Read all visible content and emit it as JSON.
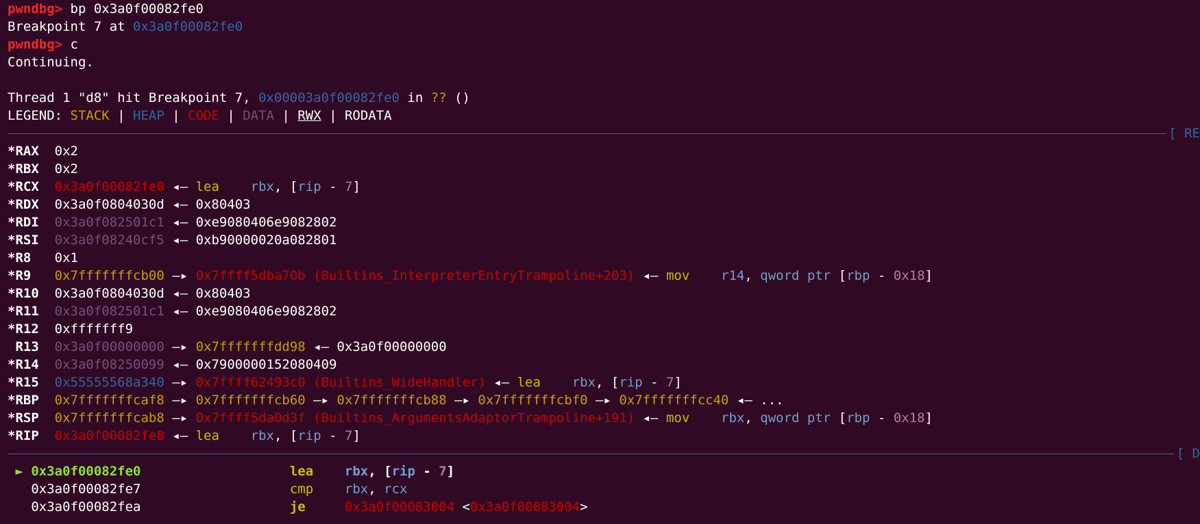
{
  "colors": {
    "background": "#300a24",
    "white": "#ffffff",
    "prompt_red": "#ef2929",
    "code_red": "#cc0000",
    "heap_blue": "#3465a4",
    "stack_yellow": "#c4a000",
    "data_purple": "#75507b",
    "reg_cyan": "#729fcf",
    "num_purple": "#ad7fa8",
    "mnem_yellow": "#c4c400",
    "green": "#8ae234",
    "sep_blue": "#3465a4"
  },
  "terminal": {
    "lines": [
      {
        "kind": "text",
        "segs": [
          {
            "t": "pwndbg> ",
            "c": "prompt_red",
            "b": true
          },
          {
            "t": "bp 0x3a0f00082fe0",
            "c": "white"
          }
        ]
      },
      {
        "kind": "text",
        "segs": [
          {
            "t": "Breakpoint 7 at ",
            "c": "white"
          },
          {
            "t": "0x3a0f00082fe0",
            "c": "heap_blue"
          }
        ]
      },
      {
        "kind": "text",
        "segs": [
          {
            "t": "pwndbg> ",
            "c": "prompt_red",
            "b": true
          },
          {
            "t": "c",
            "c": "white"
          }
        ]
      },
      {
        "kind": "text",
        "segs": [
          {
            "t": "Continuing.",
            "c": "white"
          }
        ]
      },
      {
        "kind": "text",
        "segs": []
      },
      {
        "kind": "text",
        "segs": [
          {
            "t": "Thread 1 \"d8\" hit Breakpoint 7, ",
            "c": "white"
          },
          {
            "t": "0x00003a0f00082fe0",
            "c": "heap_blue"
          },
          {
            "t": " in ",
            "c": "white"
          },
          {
            "t": "??",
            "c": "stack_yellow"
          },
          {
            "t": " ()",
            "c": "white"
          }
        ]
      },
      {
        "kind": "text",
        "segs": [
          {
            "t": "LEGEND: ",
            "c": "white"
          },
          {
            "t": "STACK",
            "c": "stack_yellow"
          },
          {
            "t": " | ",
            "c": "white"
          },
          {
            "t": "HEAP",
            "c": "heap_blue"
          },
          {
            "t": " | ",
            "c": "white"
          },
          {
            "t": "CODE",
            "c": "code_red"
          },
          {
            "t": " | ",
            "c": "white"
          },
          {
            "t": "DATA",
            "c": "data_purple"
          },
          {
            "t": " | ",
            "c": "white"
          },
          {
            "t": "RWX",
            "c": "white",
            "u": true
          },
          {
            "t": " | RODATA",
            "c": "white"
          }
        ]
      },
      {
        "kind": "sep",
        "label": "[ RE"
      },
      {
        "kind": "text",
        "segs": [
          {
            "t": "*RAX",
            "c": "white",
            "b": true
          },
          {
            "t": "  0x2",
            "c": "white"
          }
        ]
      },
      {
        "kind": "text",
        "segs": [
          {
            "t": "*RBX",
            "c": "white",
            "b": true
          },
          {
            "t": "  0x2",
            "c": "white"
          }
        ]
      },
      {
        "kind": "text",
        "segs": [
          {
            "t": "*RCX",
            "c": "white",
            "b": true
          },
          {
            "t": "  ",
            "c": "white"
          },
          {
            "t": "0x3a0f00082fe0",
            "c": "code_red"
          },
          {
            "t": " ◂— ",
            "c": "white"
          },
          {
            "t": "lea",
            "c": "mnem_yellow"
          },
          {
            "t": "    ",
            "c": "white"
          },
          {
            "t": "rbx",
            "c": "reg_cyan"
          },
          {
            "t": ", [",
            "c": "white"
          },
          {
            "t": "rip",
            "c": "reg_cyan"
          },
          {
            "t": " - ",
            "c": "white"
          },
          {
            "t": "7",
            "c": "num_purple"
          },
          {
            "t": "]",
            "c": "white"
          }
        ]
      },
      {
        "kind": "text",
        "segs": [
          {
            "t": "*RDX",
            "c": "white",
            "b": true
          },
          {
            "t": "  0x3a0f0804030d ◂— 0x80403",
            "c": "white"
          }
        ]
      },
      {
        "kind": "text",
        "segs": [
          {
            "t": "*RDI",
            "c": "white",
            "b": true
          },
          {
            "t": "  ",
            "c": "white"
          },
          {
            "t": "0x3a0f082501c1",
            "c": "data_purple"
          },
          {
            "t": " ◂— 0xe9080406e9082802",
            "c": "white"
          }
        ]
      },
      {
        "kind": "text",
        "segs": [
          {
            "t": "*RSI",
            "c": "white",
            "b": true
          },
          {
            "t": "  ",
            "c": "white"
          },
          {
            "t": "0x3a0f08240cf5",
            "c": "data_purple"
          },
          {
            "t": " ◂— 0xb90000020a082801",
            "c": "white"
          }
        ]
      },
      {
        "kind": "text",
        "segs": [
          {
            "t": "*R8",
            "c": "white",
            "b": true
          },
          {
            "t": "   0x1",
            "c": "white"
          }
        ]
      },
      {
        "kind": "text",
        "segs": [
          {
            "t": "*R9",
            "c": "white",
            "b": true
          },
          {
            "t": "   ",
            "c": "white"
          },
          {
            "t": "0x7fffffffcb00",
            "c": "stack_yellow"
          },
          {
            "t": " —▸ ",
            "c": "white"
          },
          {
            "t": "0x7ffff5dba70b (Builtins_InterpreterEntryTrampoline+203)",
            "c": "code_red"
          },
          {
            "t": " ◂— ",
            "c": "white"
          },
          {
            "t": "mov",
            "c": "mnem_yellow"
          },
          {
            "t": "    ",
            "c": "white"
          },
          {
            "t": "r14",
            "c": "reg_cyan"
          },
          {
            "t": ", ",
            "c": "white"
          },
          {
            "t": "qword ptr",
            "c": "reg_cyan"
          },
          {
            "t": " [",
            "c": "white"
          },
          {
            "t": "rbp",
            "c": "reg_cyan"
          },
          {
            "t": " - ",
            "c": "white"
          },
          {
            "t": "0x18",
            "c": "num_purple"
          },
          {
            "t": "]",
            "c": "white"
          }
        ]
      },
      {
        "kind": "text",
        "segs": [
          {
            "t": "*R10",
            "c": "white",
            "b": true
          },
          {
            "t": "  0x3a0f0804030d ◂— 0x80403",
            "c": "white"
          }
        ]
      },
      {
        "kind": "text",
        "segs": [
          {
            "t": "*R11",
            "c": "white",
            "b": true
          },
          {
            "t": "  ",
            "c": "white"
          },
          {
            "t": "0x3a0f082501c1",
            "c": "data_purple"
          },
          {
            "t": " ◂— 0xe9080406e9082802",
            "c": "white"
          }
        ]
      },
      {
        "kind": "text",
        "segs": [
          {
            "t": "*R12",
            "c": "white",
            "b": true
          },
          {
            "t": "  0xfffffff9",
            "c": "white"
          }
        ]
      },
      {
        "kind": "text",
        "segs": [
          {
            "t": " R13",
            "c": "white",
            "b": true
          },
          {
            "t": "  ",
            "c": "white"
          },
          {
            "t": "0x3a0f00000000",
            "c": "data_purple"
          },
          {
            "t": " —▸ ",
            "c": "white"
          },
          {
            "t": "0x7fffffffdd98",
            "c": "stack_yellow"
          },
          {
            "t": " ◂— 0x3a0f00000000",
            "c": "white"
          }
        ]
      },
      {
        "kind": "text",
        "segs": [
          {
            "t": "*R14",
            "c": "white",
            "b": true
          },
          {
            "t": "  ",
            "c": "white"
          },
          {
            "t": "0x3a0f08250099",
            "c": "data_purple"
          },
          {
            "t": " ◂— 0x7900000152080409",
            "c": "white"
          }
        ]
      },
      {
        "kind": "text",
        "segs": [
          {
            "t": "*R15",
            "c": "white",
            "b": true
          },
          {
            "t": "  ",
            "c": "white"
          },
          {
            "t": "0x55555568a340",
            "c": "heap_blue"
          },
          {
            "t": " —▸ ",
            "c": "white"
          },
          {
            "t": "0x7ffff62493c0 (Builtins_WideHandler)",
            "c": "code_red"
          },
          {
            "t": " ◂— ",
            "c": "white"
          },
          {
            "t": "lea",
            "c": "mnem_yellow"
          },
          {
            "t": "    ",
            "c": "white"
          },
          {
            "t": "rbx",
            "c": "reg_cyan"
          },
          {
            "t": ", [",
            "c": "white"
          },
          {
            "t": "rip",
            "c": "reg_cyan"
          },
          {
            "t": " - ",
            "c": "white"
          },
          {
            "t": "7",
            "c": "num_purple"
          },
          {
            "t": "]",
            "c": "white"
          }
        ]
      },
      {
        "kind": "text",
        "segs": [
          {
            "t": "*RBP",
            "c": "white",
            "b": true
          },
          {
            "t": "  ",
            "c": "white"
          },
          {
            "t": "0x7fffffffcaf8",
            "c": "stack_yellow"
          },
          {
            "t": " —▸ ",
            "c": "white"
          },
          {
            "t": "0x7fffffffcb60",
            "c": "stack_yellow"
          },
          {
            "t": " —▸ ",
            "c": "white"
          },
          {
            "t": "0x7fffffffcb88",
            "c": "stack_yellow"
          },
          {
            "t": " —▸ ",
            "c": "white"
          },
          {
            "t": "0x7fffffffcbf0",
            "c": "stack_yellow"
          },
          {
            "t": " —▸ ",
            "c": "white"
          },
          {
            "t": "0x7fffffffcc40",
            "c": "stack_yellow"
          },
          {
            "t": " ◂— ...",
            "c": "white"
          }
        ]
      },
      {
        "kind": "text",
        "segs": [
          {
            "t": "*RSP",
            "c": "white",
            "b": true
          },
          {
            "t": "  ",
            "c": "white"
          },
          {
            "t": "0x7fffffffcab8",
            "c": "stack_yellow"
          },
          {
            "t": " —▸ ",
            "c": "white"
          },
          {
            "t": "0x7ffff5da0d3f (Builtins_ArgumentsAdaptorTrampoline+191)",
            "c": "code_red"
          },
          {
            "t": " ◂— ",
            "c": "white"
          },
          {
            "t": "mov",
            "c": "mnem_yellow"
          },
          {
            "t": "    ",
            "c": "white"
          },
          {
            "t": "rbx",
            "c": "reg_cyan"
          },
          {
            "t": ", ",
            "c": "white"
          },
          {
            "t": "qword ptr",
            "c": "reg_cyan"
          },
          {
            "t": " [",
            "c": "white"
          },
          {
            "t": "rbp",
            "c": "reg_cyan"
          },
          {
            "t": " - ",
            "c": "white"
          },
          {
            "t": "0x18",
            "c": "num_purple"
          },
          {
            "t": "]",
            "c": "white"
          }
        ]
      },
      {
        "kind": "text",
        "segs": [
          {
            "t": "*RIP",
            "c": "white",
            "b": true
          },
          {
            "t": "  ",
            "c": "white"
          },
          {
            "t": "0x3a0f00082fe0",
            "c": "code_red"
          },
          {
            "t": " ◂— ",
            "c": "white"
          },
          {
            "t": "lea",
            "c": "mnem_yellow"
          },
          {
            "t": "    ",
            "c": "white"
          },
          {
            "t": "rbx",
            "c": "reg_cyan"
          },
          {
            "t": ", [",
            "c": "white"
          },
          {
            "t": "rip",
            "c": "reg_cyan"
          },
          {
            "t": " - ",
            "c": "white"
          },
          {
            "t": "7",
            "c": "num_purple"
          },
          {
            "t": "]",
            "c": "white"
          }
        ]
      },
      {
        "kind": "sep",
        "label": "[ D"
      },
      {
        "kind": "text",
        "segs": [
          {
            "t": " ► ",
            "c": "green",
            "b": true
          },
          {
            "t": "0x3a0f00082fe0",
            "c": "green",
            "b": true
          },
          {
            "t": "                   ",
            "c": "white"
          },
          {
            "t": "lea",
            "c": "mnem_yellow",
            "b": true
          },
          {
            "t": "    ",
            "c": "white"
          },
          {
            "t": "rbx",
            "c": "reg_cyan",
            "b": true
          },
          {
            "t": ", [",
            "c": "white",
            "b": true
          },
          {
            "t": "rip",
            "c": "reg_cyan",
            "b": true
          },
          {
            "t": " - ",
            "c": "white",
            "b": true
          },
          {
            "t": "7",
            "c": "num_purple",
            "b": true
          },
          {
            "t": "]",
            "c": "white",
            "b": true
          }
        ]
      },
      {
        "kind": "text",
        "segs": [
          {
            "t": "   0x3a0f00082fe7",
            "c": "white"
          },
          {
            "t": "                   ",
            "c": "white"
          },
          {
            "t": "cmp",
            "c": "mnem_yellow"
          },
          {
            "t": "    ",
            "c": "white"
          },
          {
            "t": "rbx",
            "c": "reg_cyan"
          },
          {
            "t": ", ",
            "c": "white"
          },
          {
            "t": "rcx",
            "c": "reg_cyan"
          }
        ]
      },
      {
        "kind": "text",
        "segs": [
          {
            "t": "   0x3a0f00082fea",
            "c": "white"
          },
          {
            "t": "                   ",
            "c": "white"
          },
          {
            "t": "je",
            "c": "mnem_yellow",
            "b": true
          },
          {
            "t": "     ",
            "c": "white"
          },
          {
            "t": "0x3a0f00083004",
            "c": "code_red"
          },
          {
            "t": " <",
            "c": "white"
          },
          {
            "t": "0x3a0f00083004",
            "c": "code_red"
          },
          {
            "t": ">",
            "c": "white"
          }
        ]
      }
    ]
  }
}
